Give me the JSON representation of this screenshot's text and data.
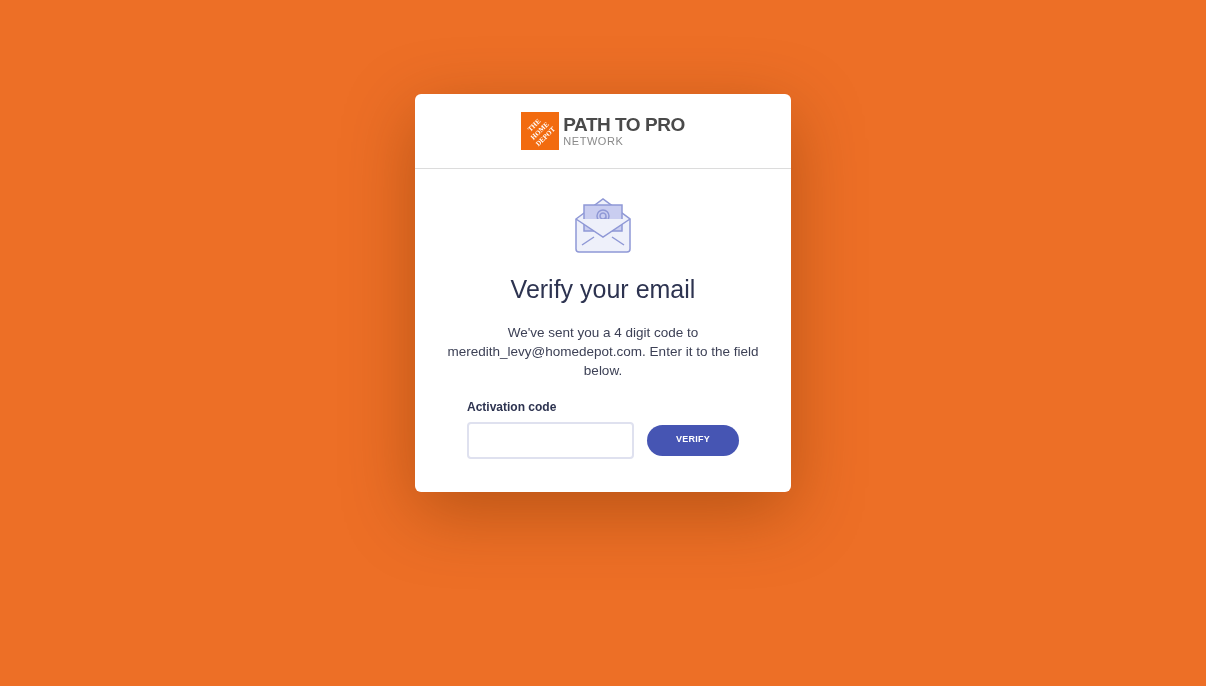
{
  "brand": {
    "logo_text": "THE HOME DEPOT",
    "title": "PATH TO PRO",
    "subtitle": "NETWORK"
  },
  "heading": "Verify your email",
  "message": "We've sent you a 4 digit code to meredith_levy@homedepot.com. Enter it to the field below.",
  "field": {
    "label": "Activation code"
  },
  "button": "VERIFY"
}
